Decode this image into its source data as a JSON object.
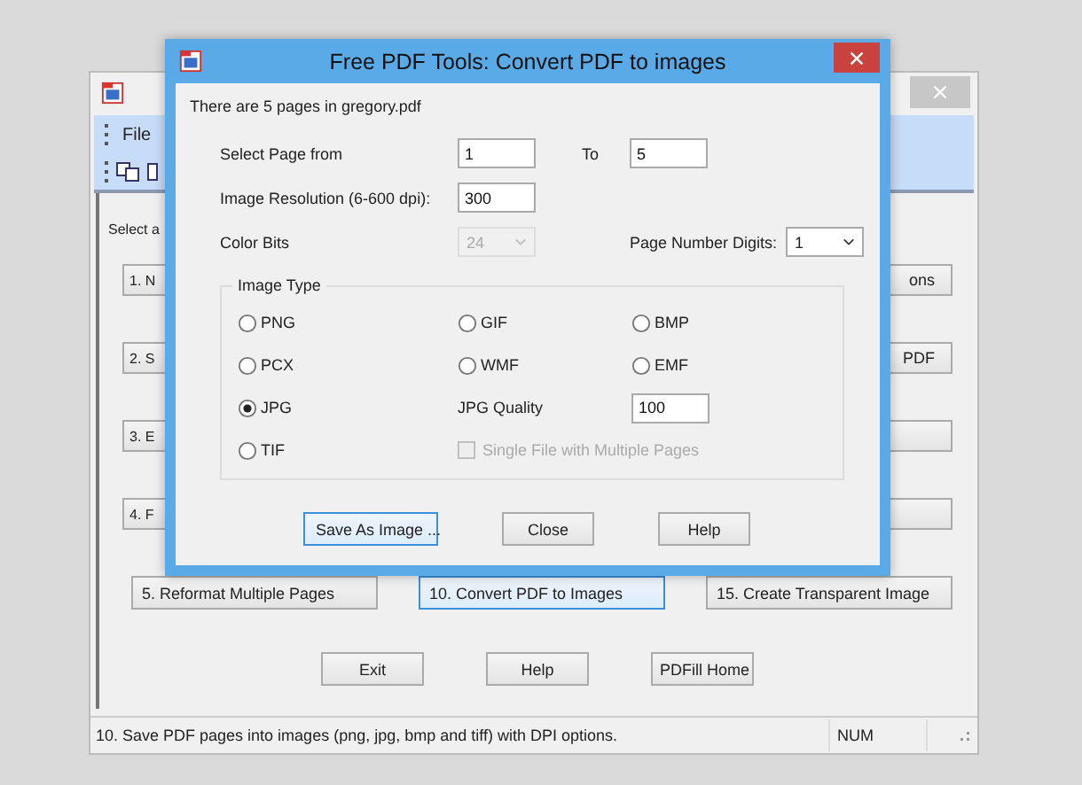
{
  "main_window": {
    "menu": [
      "File"
    ],
    "prompt": "Select a",
    "left_buttons": [
      "1. N",
      "2. S",
      "3. E",
      "4. F"
    ],
    "right_buttons": [
      {
        "kind": "text",
        "label": "ons"
      },
      {
        "kind": "text",
        "label": "PDF"
      },
      {
        "kind": "blank"
      },
      {
        "kind": "blank"
      }
    ],
    "row_buttons": [
      {
        "label": "5. Reformat Multiple Pages",
        "focused": false
      },
      {
        "label": "10. Convert PDF to Images",
        "focused": true
      },
      {
        "label": "15. Create Transparent Image",
        "focused": false
      }
    ],
    "bottom_buttons": [
      "Exit",
      "Help",
      "PDFill Home"
    ],
    "status_bar": {
      "message": "10. Save PDF pages into images (png, jpg, bmp and tiff) with DPI options.",
      "indicator": "NUM"
    }
  },
  "dialog": {
    "title": "Free PDF Tools: Convert PDF to images",
    "info": "There are 5 pages in gregory.pdf",
    "page_from": {
      "label": "Select Page from",
      "value": "1"
    },
    "page_to": {
      "label": "To",
      "value": "5"
    },
    "resolution": {
      "label": "Image Resolution (6-600 dpi):",
      "value": "300"
    },
    "color_bits": {
      "label": "Color Bits",
      "value": "24",
      "disabled": true
    },
    "page_number_digits": {
      "label": "Page Number Digits:",
      "value": "1",
      "disabled": false
    },
    "image_type": {
      "title": "Image Type",
      "options": [
        {
          "label": "PNG",
          "selected": false
        },
        {
          "label": "GIF",
          "selected": false
        },
        {
          "label": "BMP",
          "selected": false
        },
        {
          "label": "PCX",
          "selected": false
        },
        {
          "label": "WMF",
          "selected": false
        },
        {
          "label": "EMF",
          "selected": false
        },
        {
          "label": "JPG",
          "selected": true
        },
        {
          "label": "TIF",
          "selected": false
        }
      ]
    },
    "jpg_quality": {
      "label": "JPG Quality",
      "value": "100"
    },
    "single_file": {
      "label": "Single File with Multiple Pages",
      "checked": false,
      "disabled": true
    },
    "buttons": [
      {
        "label": "Save As Image ...",
        "focused": true
      },
      {
        "label": "Close",
        "focused": false
      },
      {
        "label": "Help",
        "focused": false
      }
    ]
  }
}
